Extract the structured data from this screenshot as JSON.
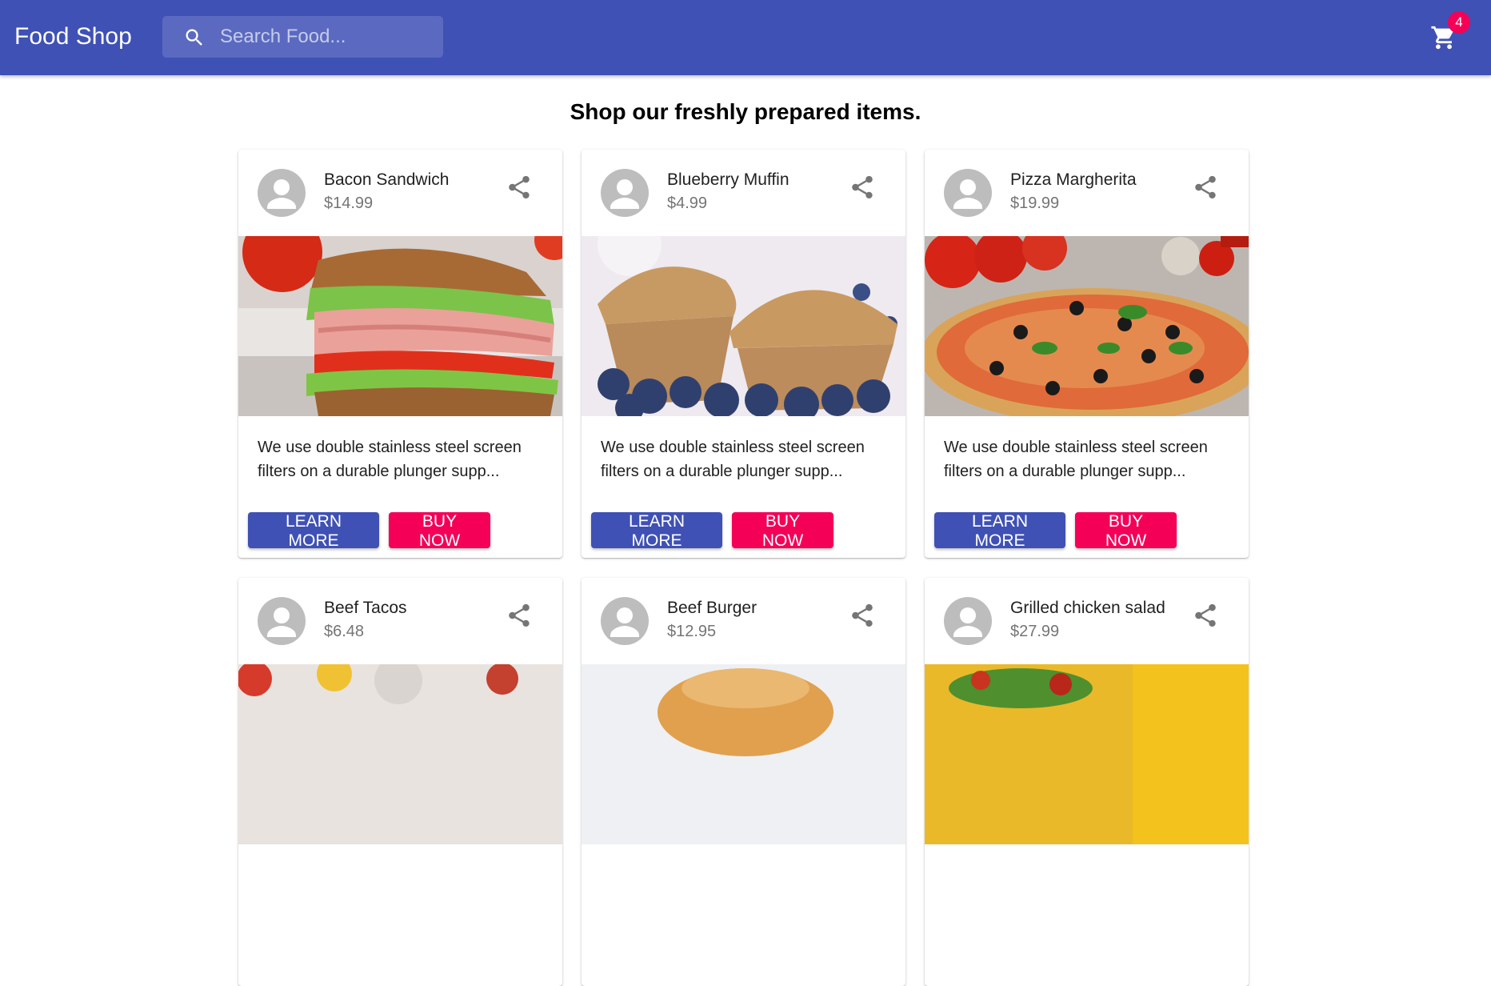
{
  "appbar": {
    "brand": "Food Shop",
    "search_placeholder": "Search Food...",
    "cart_count": "4",
    "color": "#3f51b5"
  },
  "heading": "Shop our freshly prepared items.",
  "accent": {
    "primary": "#3f51b5",
    "secondary": "#f50057"
  },
  "cards": [
    {
      "title": "Bacon Sandwich",
      "price": "$14.99",
      "image": "bacon-sandwich-photo",
      "description": "We use double stainless steel screen filters on a durable plunger supp...",
      "learn_more": "Learn More",
      "buy_now": "Buy Now"
    },
    {
      "title": "Blueberry Muffin",
      "price": "$4.99",
      "image": "blueberry-muffin-photo",
      "description": "We use double stainless steel screen filters on a durable plunger supp...",
      "learn_more": "Learn More",
      "buy_now": "Buy Now"
    },
    {
      "title": "Pizza Margherita",
      "price": "$19.99",
      "image": "pizza-margherita-photo",
      "description": "We use double stainless steel screen filters on a durable plunger supp...",
      "learn_more": "Learn More",
      "buy_now": "Buy Now"
    },
    {
      "title": "Beef Tacos",
      "price": "$6.48",
      "image": "beef-tacos-photo"
    },
    {
      "title": "Beef Burger",
      "price": "$12.95",
      "image": "beef-burger-photo"
    },
    {
      "title": "Grilled chicken salad",
      "price": "$27.99",
      "image": "grilled-chicken-salad-photo"
    }
  ]
}
